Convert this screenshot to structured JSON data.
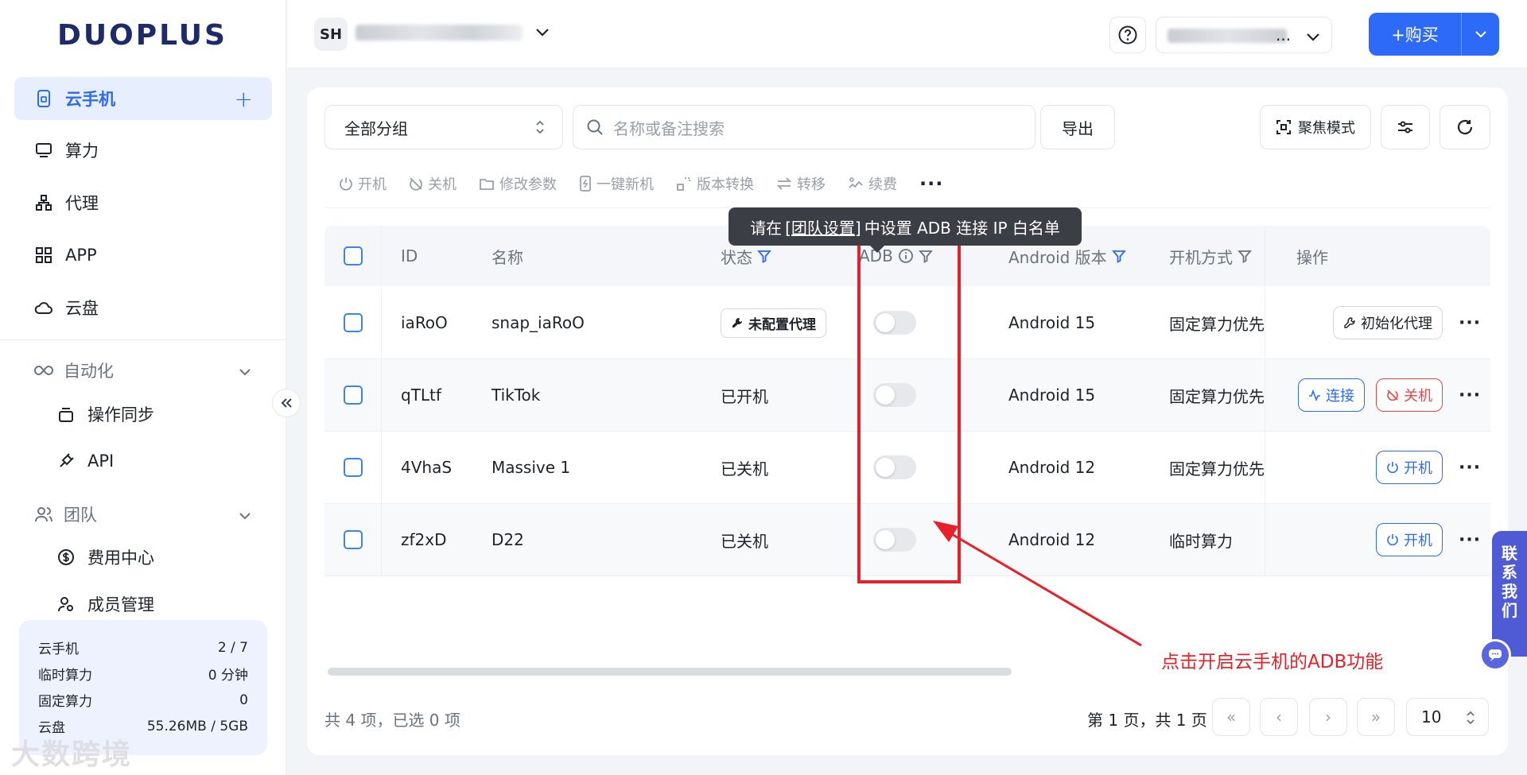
{
  "brand": {
    "logo_text": "DUOPLUS"
  },
  "sidebar": {
    "cloud_phone": "云手机",
    "items": [
      "算力",
      "代理",
      "APP",
      "云盘"
    ],
    "automation": {
      "label": "自动化",
      "children": [
        "操作同步",
        "API"
      ]
    },
    "team": {
      "label": "团队",
      "children": [
        "费用中心",
        "成员管理"
      ]
    },
    "quota": [
      {
        "label": "云手机",
        "value": "2 / 7"
      },
      {
        "label": "临时算力",
        "value": "0 分钟"
      },
      {
        "label": "固定算力",
        "value": "0"
      },
      {
        "label": "云盘",
        "value": "55.26MB / 5GB"
      }
    ],
    "watermark": "大数跨境"
  },
  "header": {
    "team_initials": "SH",
    "account_ellipsis": "...",
    "buy_label": "+购买"
  },
  "controls": {
    "group_select": "全部分组",
    "search_placeholder": "名称或备注搜索",
    "export": "导出",
    "focus_mode": "聚焦模式"
  },
  "toolbar": [
    "开机",
    "关机",
    "修改参数",
    "一键新机",
    "版本转换",
    "转移",
    "续费"
  ],
  "tooltip": {
    "before": "请在",
    "link": "[团队设置]",
    "after": "中设置 ADB 连接 IP 白名单"
  },
  "table": {
    "headers": {
      "id": "ID",
      "name": "名称",
      "status": "状态",
      "adb": "ADB",
      "android": "Android 版本",
      "boot": "开机方式",
      "ops": "操作"
    },
    "rows": [
      {
        "id": "iaRoO",
        "name": "snap_iaRoO",
        "status": "未配置代理",
        "android": "Android 15",
        "boot": "固定算力优先",
        "action": "初始化代理"
      },
      {
        "id": "qTLtf",
        "name": "TikTok",
        "status": "已开机",
        "android": "Android 15",
        "boot": "固定算力优先",
        "action_connect": "连接",
        "action_off": "关机"
      },
      {
        "id": "4VhaS",
        "name": "Massive 1",
        "status": "已关机",
        "android": "Android 12",
        "boot": "固定算力优先",
        "action": "开机"
      },
      {
        "id": "zf2xD",
        "name": "D22",
        "status": "已关机",
        "android": "Android 12",
        "boot": "临时算力",
        "action": "开机"
      }
    ]
  },
  "footer": {
    "count": "共 4 项，已选 0 项",
    "page_info": "第 1 页，共 1 页",
    "page_size": "10"
  },
  "annotation": {
    "text": "点击开启云手机的ADB功能"
  },
  "contact": {
    "label": [
      "联",
      "系",
      "我",
      "们"
    ]
  },
  "colors": {
    "primary": "#2d6af7",
    "danger": "#ef4444",
    "annotation": "#e8202a"
  }
}
